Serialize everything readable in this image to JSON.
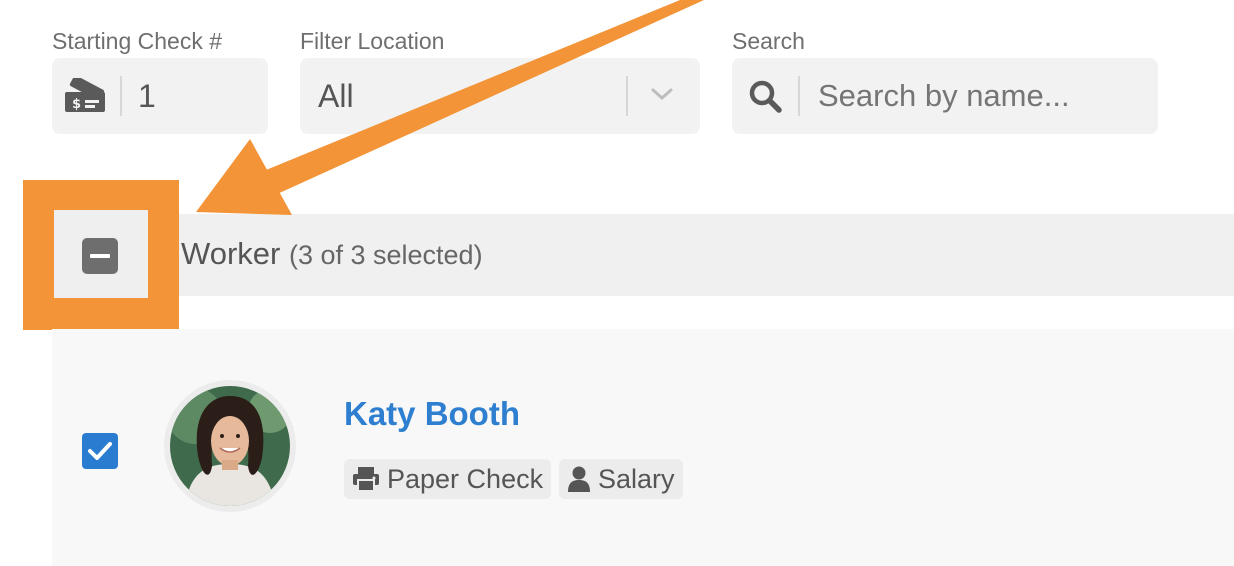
{
  "filters": {
    "starting_check": {
      "label": "Starting Check #",
      "value": "1"
    },
    "location": {
      "label": "Filter Location",
      "selected": "All"
    },
    "search": {
      "label": "Search",
      "placeholder": "Search by name..."
    }
  },
  "worker_header": {
    "title": "Worker",
    "count": "(3 of 3 selected)"
  },
  "workers": [
    {
      "name": "Katy Booth",
      "tags": [
        "Paper Check",
        "Salary"
      ],
      "selected": true
    }
  ],
  "colors": {
    "accent_orange": "#f29437",
    "link_blue": "#2e7fd0",
    "checkbox_blue": "#2a7cd0",
    "field_bg": "#f2f2f2"
  },
  "icons": {
    "starting_check": "check-money-icon",
    "location_dropdown": "chevron-down-icon",
    "search": "search-icon",
    "tag_paper_check": "printer-icon",
    "tag_salary": "user-icon"
  }
}
